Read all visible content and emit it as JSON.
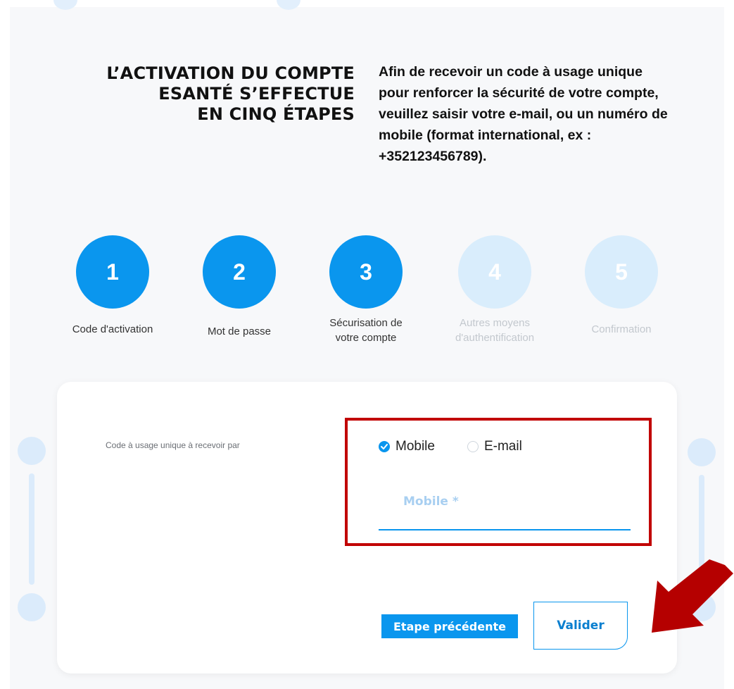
{
  "intro": {
    "title_line1": "L’ACTIVATION DU COMPTE",
    "title_line2": "ESANTÉ S’EFFECTUE",
    "title_line3": "EN CINQ ÉTAPES",
    "text": "Afin de recevoir un code à usage unique pour renforcer la sécurité de votre compte, veuillez saisir votre e-mail, ou un numéro de mobile (format international, ex : +352123456789)."
  },
  "steps": [
    {
      "number": "1",
      "label_line1": "Code d'activation",
      "label_line2": "",
      "status": "active"
    },
    {
      "number": "2",
      "label_line1": "Mot de passe",
      "label_line2": "",
      "status": "active"
    },
    {
      "number": "3",
      "label_line1": "Sécurisation de",
      "label_line2": "votre compte",
      "status": "active"
    },
    {
      "number": "4",
      "label_line1": "Autres moyens",
      "label_line2": "d'authentification",
      "status": "inactive"
    },
    {
      "number": "5",
      "label_line1": "Confirmation",
      "label_line2": "",
      "status": "inactive"
    }
  ],
  "form": {
    "otp_label": "Code à usage unique à recevoir par",
    "options": [
      {
        "label": "Mobile",
        "selected": true
      },
      {
        "label": "E-mail",
        "selected": false
      }
    ],
    "mobile_placeholder": "Mobile *",
    "mobile_value": ""
  },
  "buttons": {
    "previous": "Etape précédente",
    "validate": "Valider"
  },
  "colors": {
    "accent": "#0a96ee",
    "inactive_step": "#d9edfc",
    "highlight": "#c10000"
  }
}
